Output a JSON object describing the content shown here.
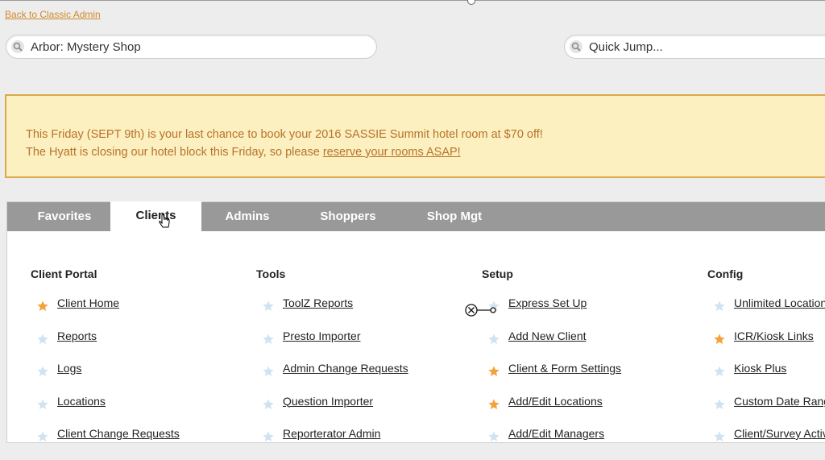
{
  "back_link": "Back to Classic Admin",
  "search_client": {
    "value": "Arbor: Mystery Shop",
    "icon": "magnifier-icon"
  },
  "quick_jump": {
    "placeholder": "Quick Jump...",
    "icon": "magnifier-icon"
  },
  "notice": {
    "line1": "This Friday (SEPT 9th) is your last chance to book your 2016 SASSIE Summit hotel room at $70 off!",
    "line2_prefix": "The Hyatt is closing our hotel block this Friday, so please ",
    "line2_link": "reserve your rooms ASAP!",
    "colors": {
      "background": "#fcefc0",
      "border": "#dba94b",
      "text": "#b7742a"
    }
  },
  "tabs": [
    {
      "label": "Favorites",
      "active": false
    },
    {
      "label": "Clients",
      "active": true
    },
    {
      "label": "Admins",
      "active": false
    },
    {
      "label": "Shoppers",
      "active": false
    },
    {
      "label": "Shop Mgt",
      "active": false
    }
  ],
  "columns": [
    {
      "title": "Client Portal",
      "items": [
        {
          "label": "Client Home",
          "star": "orange"
        },
        {
          "label": "Reports",
          "star": "blue"
        },
        {
          "label": "Logs",
          "star": "blue"
        },
        {
          "label": "Locations",
          "star": "blue"
        },
        {
          "label": "Client Change Requests",
          "star": "blue"
        }
      ]
    },
    {
      "title": "Tools",
      "items": [
        {
          "label": "ToolZ Reports",
          "star": "blue"
        },
        {
          "label": "Presto Importer",
          "star": "blue"
        },
        {
          "label": "Admin Change Requests",
          "star": "blue"
        },
        {
          "label": "Question Importer",
          "star": "blue"
        },
        {
          "label": "Reporterator Admin",
          "star": "blue"
        }
      ]
    },
    {
      "title": "Setup",
      "items": [
        {
          "label": "Express Set Up",
          "star": "blue"
        },
        {
          "label": "Add New Client",
          "star": "blue"
        },
        {
          "label": "Client & Form Settings",
          "star": "orange"
        },
        {
          "label": "Add/Edit Locations",
          "star": "orange"
        },
        {
          "label": "Add/Edit Managers",
          "star": "blue"
        }
      ]
    },
    {
      "title": "Config",
      "items": [
        {
          "label": "Unlimited Locations",
          "star": "blue"
        },
        {
          "label": "ICR/Kiosk Links",
          "star": "orange"
        },
        {
          "label": "Kiosk Plus",
          "star": "blue"
        },
        {
          "label": "Custom Date Ranges",
          "star": "blue"
        },
        {
          "label": "Client/Survey Activity",
          "star": "blue"
        }
      ]
    }
  ],
  "star_colors": {
    "orange": "#f5a13a",
    "blue": "#cfe3f2"
  }
}
